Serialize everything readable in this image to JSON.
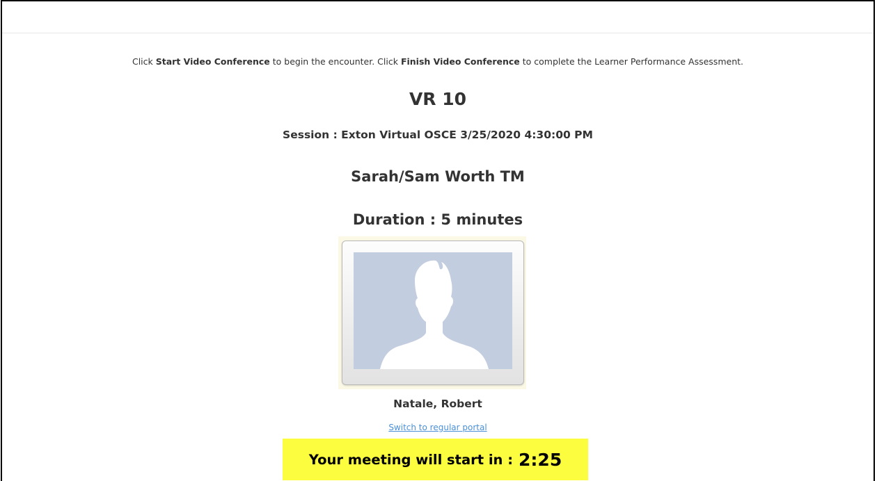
{
  "instructions": {
    "part1": "Click ",
    "start_label": "Start Video Conference",
    "part2": " to begin the encounter. Click ",
    "finish_label": "Finish Video Conference",
    "part3": " to complete the Learner Performance Assessment."
  },
  "station_title": "VR 10",
  "session_line": "Session : Exton Virtual OSCE 3/25/2020 4:30:00 PM",
  "standardized_patient": "Sarah/Sam Worth TM",
  "duration_line": "Duration : 5 minutes",
  "learner": {
    "name": "Natale, Robert",
    "avatar_icon": "person-silhouette-icon"
  },
  "switch_portal_link": "Switch to regular portal",
  "countdown": {
    "label": "Your meeting will start in :",
    "time": "2:25",
    "highlight_color": "#fdfd3f"
  },
  "colors": {
    "link": "#4a90d9",
    "text": "#333333",
    "avatar_bg": "#c3cde0"
  }
}
